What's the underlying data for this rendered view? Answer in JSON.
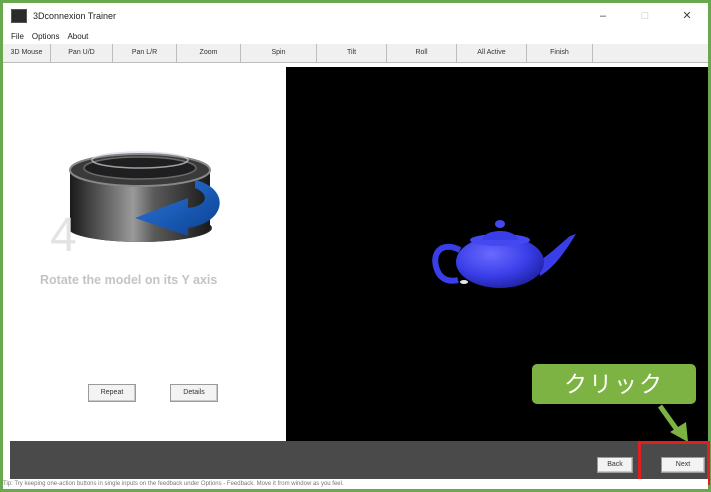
{
  "window": {
    "title": "3Dconnexion Trainer",
    "controls": [
      "–",
      "□",
      "✕"
    ]
  },
  "menu": [
    "File",
    "Options",
    "About"
  ],
  "tabs": [
    "3D Mouse",
    "Pan U/D",
    "Pan L/R",
    "Zoom",
    "Spin",
    "Tilt",
    "Roll",
    "All Active",
    "Finish"
  ],
  "step": {
    "number": "4",
    "instruction": "Rotate the model on its Y axis",
    "repeat_label": "Repeat",
    "details_label": "Details"
  },
  "nav": {
    "back_label": "Back",
    "next_label": "Next"
  },
  "callout_text": "クリック",
  "status_text": "Tip: Try keeping one-action buttons in single inputs on the feedback under Options - Feedback. Move it from window as you feel.",
  "colors": {
    "accent_green": "#7cb342",
    "highlight_red": "#e02020",
    "teapot_blue": "#3a3ee8"
  }
}
